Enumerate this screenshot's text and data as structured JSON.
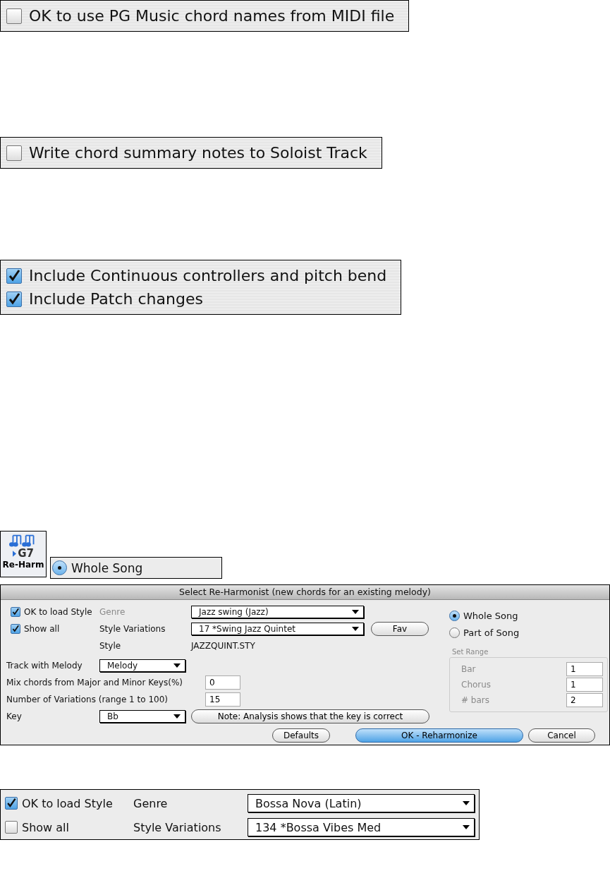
{
  "checkbox_panels": [
    {
      "items": [
        {
          "label": "OK to use PG Music chord names from MIDI file",
          "checked": false
        }
      ]
    },
    {
      "items": [
        {
          "label": "Write chord summary notes to Soloist Track",
          "checked": false
        }
      ]
    },
    {
      "items": [
        {
          "label": "Include Continuous controllers and pitch bend",
          "checked": true
        },
        {
          "label": "Include Patch changes",
          "checked": true
        }
      ]
    }
  ],
  "toolbar_button": {
    "chord": "G7",
    "label": "Re-Harm"
  },
  "range_radio": {
    "label": "Whole Song",
    "selected": true
  },
  "dialog": {
    "title": "Select Re-Harmonist (new chords for an existing melody)",
    "ok_to_load_style": {
      "label": "OK to load Style",
      "checked": true
    },
    "show_all": {
      "label": "Show all",
      "checked": true
    },
    "genre": {
      "label": "Genre",
      "value": "Jazz  swing (Jazz)",
      "disabled": true
    },
    "style_variations": {
      "label": "Style Variations",
      "value": "17 *Swing Jazz Quintet"
    },
    "fav": "Fav",
    "style": {
      "label": "Style",
      "value": "JAZZQUINT.STY"
    },
    "track_with_melody": {
      "label": "Track with Melody",
      "value": "Melody"
    },
    "mix_chords": {
      "label": "Mix chords from Major and Minor Keys(%)",
      "value": "0"
    },
    "num_variations": {
      "label": "Number of Variations (range 1 to 100)",
      "value": "15"
    },
    "key": {
      "label": "Key",
      "value": "Bb"
    },
    "note_button": "Note: Analysis shows that the key is correct",
    "range_options": [
      {
        "label": "Whole Song",
        "selected": true
      },
      {
        "label": "Part of Song",
        "selected": false
      }
    ],
    "set_range": {
      "title": "Set Range",
      "disabled": true,
      "fields": [
        {
          "label": "Bar",
          "value": "1"
        },
        {
          "label": "Chorus",
          "value": "1"
        },
        {
          "label": "# bars",
          "value": "2"
        }
      ]
    },
    "buttons": [
      {
        "label": "Defaults",
        "kind": "normal"
      },
      {
        "label": "OK - Reharmonize",
        "kind": "default"
      },
      {
        "label": "Cancel",
        "kind": "normal"
      }
    ]
  },
  "bottom_panel": {
    "ok_to_load_style": {
      "label": "OK to load Style",
      "checked": true
    },
    "show_all": {
      "label": "Show all",
      "checked": false
    },
    "genre": {
      "label": "Genre",
      "value": "Bossa Nova (Latin)",
      "disabled": false
    },
    "style_variations": {
      "label": "Style Variations",
      "value": "134 *Bossa Vibes Med"
    }
  }
}
